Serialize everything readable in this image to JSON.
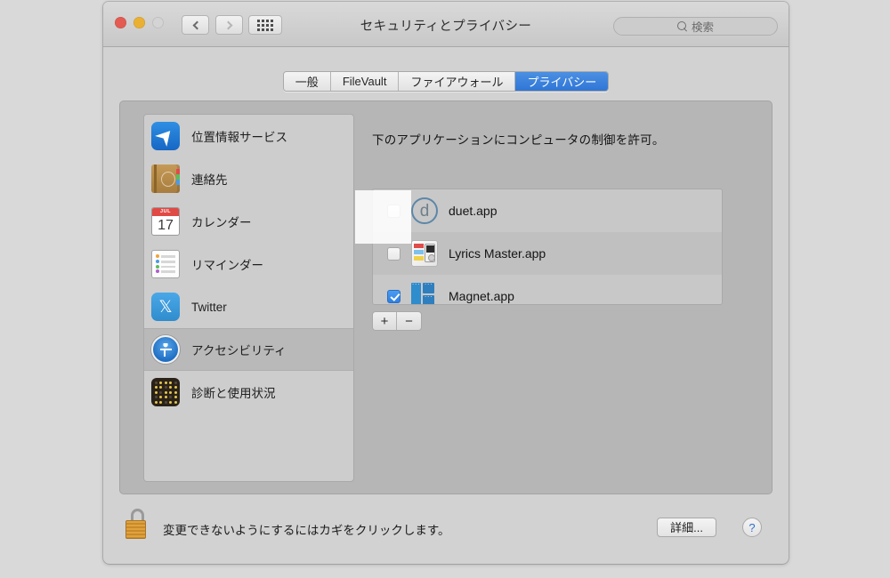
{
  "window": {
    "title": "セキュリティとプライバシー",
    "traffic_lights": [
      "close-button",
      "minimize-button",
      "zoom-button"
    ],
    "nav": {
      "back_label": "‹",
      "forward_label": "›"
    },
    "grid_button": "show-all-preferences"
  },
  "search": {
    "placeholder": "検索",
    "icon": "search-icon"
  },
  "tabs": [
    {
      "label": "一般",
      "active": false
    },
    {
      "label": "FileVault",
      "active": false
    },
    {
      "label": "ファイアウォール",
      "active": false
    },
    {
      "label": "プライバシー",
      "active": true
    }
  ],
  "sidebar": {
    "items": [
      {
        "label": "位置情報サービス",
        "icon": "location-services-icon",
        "selected": false
      },
      {
        "label": "連絡先",
        "icon": "contacts-icon",
        "selected": false
      },
      {
        "label": "カレンダー",
        "icon": "calendar-icon",
        "selected": false,
        "calendar_month": "JUL",
        "calendar_day": "17"
      },
      {
        "label": "リマインダー",
        "icon": "reminders-icon",
        "selected": false
      },
      {
        "label": "Twitter",
        "icon": "twitter-icon",
        "selected": false
      },
      {
        "label": "アクセシビリティ",
        "icon": "accessibility-icon",
        "selected": true
      },
      {
        "label": "診断と使用状況",
        "icon": "diagnostics-icon",
        "selected": false
      }
    ]
  },
  "main": {
    "description": "下のアプリケーションにコンピュータの制御を許可。",
    "apps": [
      {
        "name": "duet.app",
        "checked": false,
        "icon": "duet-app-icon",
        "glyph": "d"
      },
      {
        "name": "Lyrics Master.app",
        "checked": false,
        "icon": "lyrics-master-app-icon"
      },
      {
        "name": "Magnet.app",
        "checked": true,
        "icon": "magnet-app-icon"
      }
    ],
    "add_label": "+",
    "remove_label": "−"
  },
  "bottom": {
    "lock_icon": "unlocked-padlock-icon",
    "lock_text": "変更できないようにするにはカギをクリックします。",
    "advanced_label": "詳細...",
    "help_label": "?"
  },
  "colors": {
    "accent_blue": "#2f76d6",
    "checkbox_blue": "#2f7fe0",
    "window_bg": "#d2d2d2",
    "panel_bg": "#b6b6b6",
    "list_bg": "#c8c8c8"
  }
}
